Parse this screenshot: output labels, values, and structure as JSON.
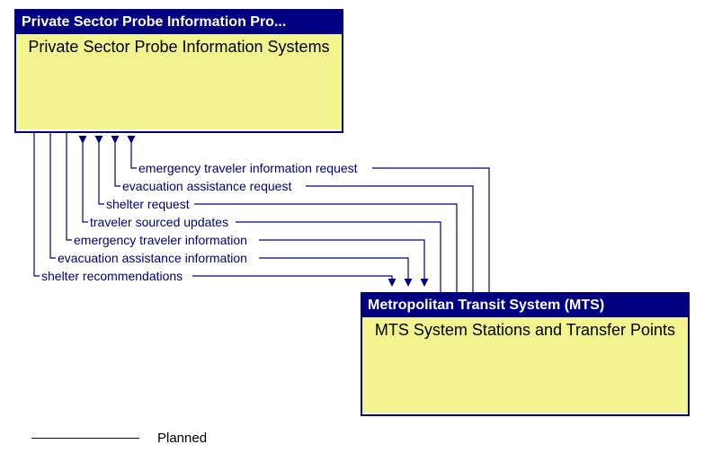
{
  "box_top": {
    "header": "Private Sector Probe Information Pro...",
    "body": "Private Sector Probe Information Systems"
  },
  "box_bottom": {
    "header": "Metropolitan Transit System (MTS)",
    "body": "MTS System Stations and Transfer Points"
  },
  "flows": {
    "f1": "emergency traveler information request",
    "f2": "evacuation assistance request",
    "f3": "shelter request",
    "f4": "traveler sourced updates",
    "f5": "emergency traveler information",
    "f6": "evacuation assistance information",
    "f7": "shelter recommendations"
  },
  "legend": {
    "planned": "Planned"
  }
}
